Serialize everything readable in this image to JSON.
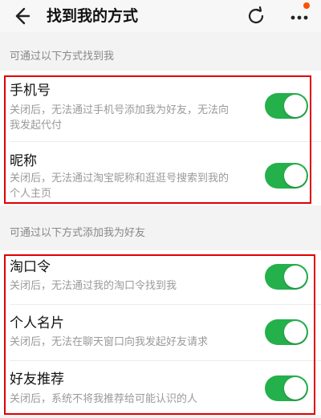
{
  "header": {
    "title": "找到我的方式",
    "back_icon": "arrow-left-icon",
    "refresh_icon": "refresh-icon",
    "more_icon": "more-dots-icon",
    "notification_dot_color": "#ff5000"
  },
  "sections": [
    {
      "label": "可通过以下方式找到我",
      "items": [
        {
          "title": "手机号",
          "desc_line1": "关闭后，无法通过手机号添加我为好友，无法向",
          "desc_line2": "我发起代付",
          "enabled": true
        },
        {
          "title": "昵称",
          "desc_line1": "关闭后，无法通过淘宝昵称和逛逛号搜索到我的",
          "desc_line2": "个人主页",
          "enabled": true
        }
      ]
    },
    {
      "label": "可通过以下方式添加我为好友",
      "items": [
        {
          "title": "淘口令",
          "desc_line1": "关闭后，无法通过我的淘口令找到我",
          "enabled": true
        },
        {
          "title": "个人名片",
          "desc_line1": "关闭后，无法在聊天窗口向我发起好友请求",
          "enabled": true
        },
        {
          "title": "好友推荐",
          "desc_line1": "关闭后，系统不将我推荐给可能认识的人",
          "enabled": true
        }
      ]
    }
  ],
  "colors": {
    "toggle_on": "#24b04b",
    "highlight": "#e00000"
  }
}
